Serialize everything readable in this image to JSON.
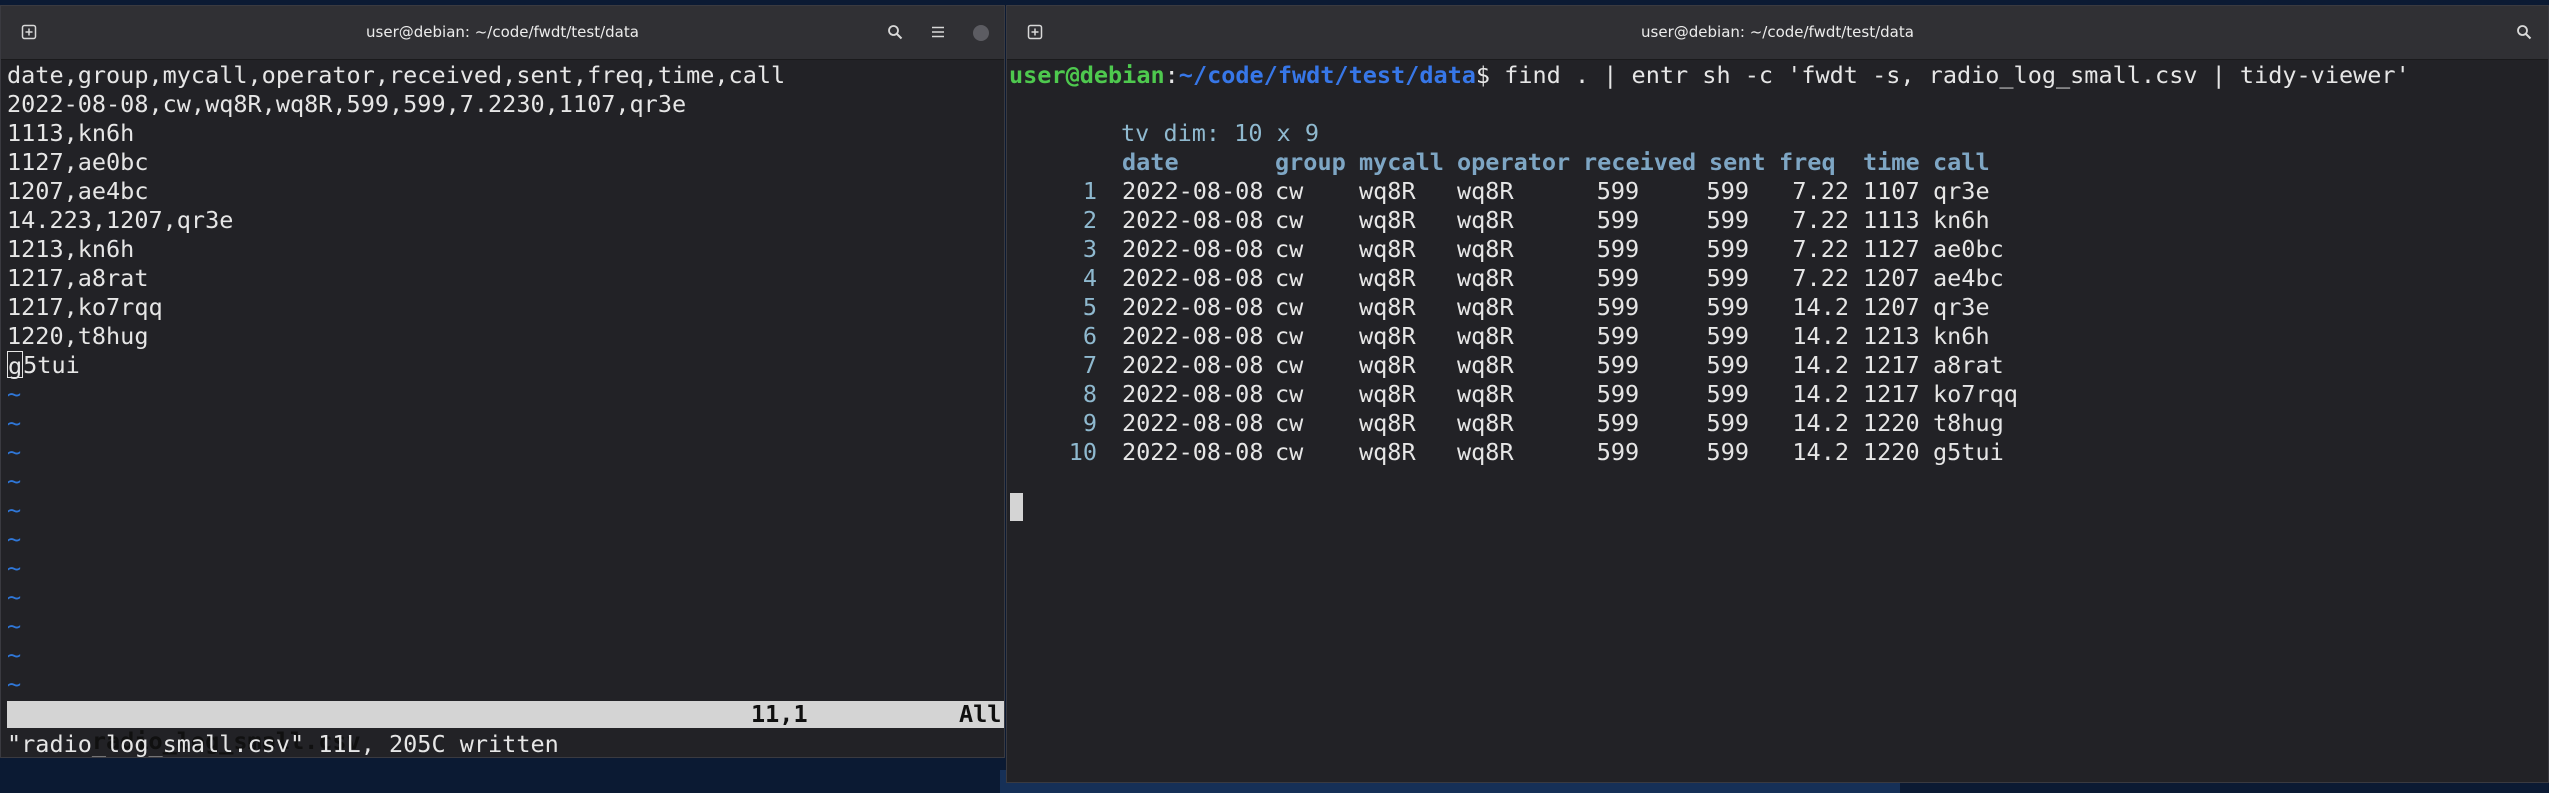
{
  "left_window": {
    "title": "user@debian: ~/code/fwdt/test/data",
    "lines": [
      "date,group,mycall,operator,received,sent,freq,time,call",
      "2022-08-08,cw,wq8R,wq8R,599,599,7.2230,1107,qr3e",
      "1113,kn6h",
      "1127,ae0bc",
      "1207,ae4bc",
      "14.223,1207,qr3e",
      "1213,kn6h",
      "1217,a8rat",
      "1217,ko7rqq",
      "1220,t8hug"
    ],
    "cursor_line": {
      "char": "g",
      "rest": "5tui"
    },
    "tilde": "~",
    "status": {
      "filename": "radio_log_small.csv",
      "position": "11,1",
      "scroll": "All"
    },
    "message": "\"radio_log_small.csv\" 11L, 205C written"
  },
  "right_window": {
    "title": "user@debian: ~/code/fwdt/test/data",
    "prompt": {
      "user": "user@debian",
      "sep": ":",
      "path": "~/code/fwdt/test/data",
      "symbol": "$",
      "command": " find . | entr sh -c 'fwdt -s, radio_log_small.csv | tidy-viewer'"
    },
    "tv_dim": "tv dim: 10 x 9",
    "headers": [
      "date",
      "group",
      "mycall",
      "operator",
      "received",
      "sent",
      "freq",
      "time",
      "call"
    ],
    "rows": [
      [
        "1",
        "2022-08-08",
        "cw",
        "wq8R",
        "wq8R",
        "599",
        "599",
        "7.22",
        "1107",
        "qr3e"
      ],
      [
        "2",
        "2022-08-08",
        "cw",
        "wq8R",
        "wq8R",
        "599",
        "599",
        "7.22",
        "1113",
        "kn6h"
      ],
      [
        "3",
        "2022-08-08",
        "cw",
        "wq8R",
        "wq8R",
        "599",
        "599",
        "7.22",
        "1127",
        "ae0bc"
      ],
      [
        "4",
        "2022-08-08",
        "cw",
        "wq8R",
        "wq8R",
        "599",
        "599",
        "7.22",
        "1207",
        "ae4bc"
      ],
      [
        "5",
        "2022-08-08",
        "cw",
        "wq8R",
        "wq8R",
        "599",
        "599",
        "14.2",
        "1207",
        "qr3e"
      ],
      [
        "6",
        "2022-08-08",
        "cw",
        "wq8R",
        "wq8R",
        "599",
        "599",
        "14.2",
        "1213",
        "kn6h"
      ],
      [
        "7",
        "2022-08-08",
        "cw",
        "wq8R",
        "wq8R",
        "599",
        "599",
        "14.2",
        "1217",
        "a8rat"
      ],
      [
        "8",
        "2022-08-08",
        "cw",
        "wq8R",
        "wq8R",
        "599",
        "599",
        "14.2",
        "1217",
        "ko7rqq"
      ],
      [
        "9",
        "2022-08-08",
        "cw",
        "wq8R",
        "wq8R",
        "599",
        "599",
        "14.2",
        "1220",
        "t8hug"
      ],
      [
        "10",
        "2022-08-08",
        "cw",
        "wq8R",
        "wq8R",
        "599",
        "599",
        "14.2",
        "1220",
        "g5tui"
      ]
    ]
  },
  "icons": {
    "new_tab": "new-tab-icon",
    "search": "search-icon",
    "menu": "hamburger-menu-icon",
    "close": "close-icon"
  },
  "colors": {
    "prompt_user": "#4ec94e",
    "prompt_path": "#3777e8",
    "table_header": "#7ea6c4",
    "vim_tilde": "#2f77d8"
  }
}
